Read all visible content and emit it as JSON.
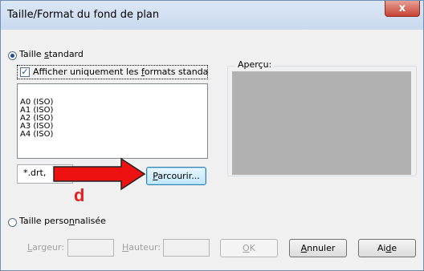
{
  "dialog": {
    "title": "Taille/Format du fond de plan",
    "close_glyph": "x"
  },
  "standard": {
    "radio_label_pre": "Taille ",
    "radio_label_u": "s",
    "radio_label_post": "tandard",
    "selected": true,
    "checkbox_checked": true,
    "checkbox_label_pre": "Afficher uniquement les ",
    "checkbox_label_u": "f",
    "checkbox_label_post": "ormats standa",
    "formats": [
      "A0 (ISO)",
      "A1 (ISO)",
      "A2 (ISO)",
      "A3 (ISO)",
      "A4 (ISO)"
    ],
    "file_filter": "*.drt,",
    "browse_pre": "",
    "browse_u": "P",
    "browse_post": "arcourir..."
  },
  "preview": {
    "label": "Aperçu:"
  },
  "custom": {
    "radio_label_pre": "Taille perso",
    "radio_label_u": "n",
    "radio_label_post": "nalisée",
    "selected": false,
    "width_label_pre": "",
    "width_label_u": "L",
    "width_label_post": "argeur:",
    "height_label_pre": "",
    "height_label_u": "H",
    "height_label_post": "auteur:"
  },
  "buttons": {
    "ok_u": "O",
    "ok_post": "K",
    "cancel_u": "A",
    "cancel_post": "nnuler",
    "help_pre": "Ai",
    "help_u": "d",
    "help_post": "e"
  },
  "annotation": {
    "letter": "d",
    "color": "#e81f1f"
  }
}
